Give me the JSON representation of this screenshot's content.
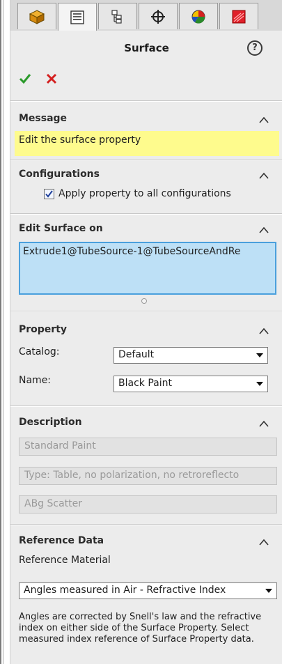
{
  "tabs": [
    {
      "icon": "feature-manager-icon"
    },
    {
      "icon": "property-manager-icon"
    },
    {
      "icon": "configuration-manager-icon"
    },
    {
      "icon": "dimxpert-icon"
    },
    {
      "icon": "display-manager-icon"
    },
    {
      "icon": "optical-plugin-icon"
    }
  ],
  "header": {
    "title": "Surface",
    "help": "?"
  },
  "message": {
    "title": "Message",
    "text": "Edit the surface property"
  },
  "configurations": {
    "title": "Configurations",
    "apply_all_label": "Apply property to all configurations",
    "apply_all_checked": true
  },
  "edit_surface": {
    "title": "Edit Surface on",
    "items": [
      "Extrude1@TubeSource-1@TubeSourceAndRe"
    ]
  },
  "property": {
    "title": "Property",
    "catalog_label": "Catalog:",
    "catalog_value": "Default",
    "name_label": "Name:",
    "name_value": "Black Paint"
  },
  "description": {
    "title": "Description",
    "line1": "Standard Paint",
    "line2": "Type: Table, no polarization, no retroreflecto",
    "line3": "ABg Scatter"
  },
  "reference_data": {
    "title": "Reference Data",
    "material_label": "Reference Material",
    "angles_value": "Angles measured in Air - Refractive Index",
    "note": "Angles are corrected by Snell's law and the refractive index on either side of the Surface Property. Select measured index reference of Surface Property data."
  },
  "colors": {
    "accent_blue": "#4aa0dd",
    "message_yellow": "#fefb8d",
    "ok_green": "#2a9a2a",
    "cancel_red": "#d42020"
  }
}
